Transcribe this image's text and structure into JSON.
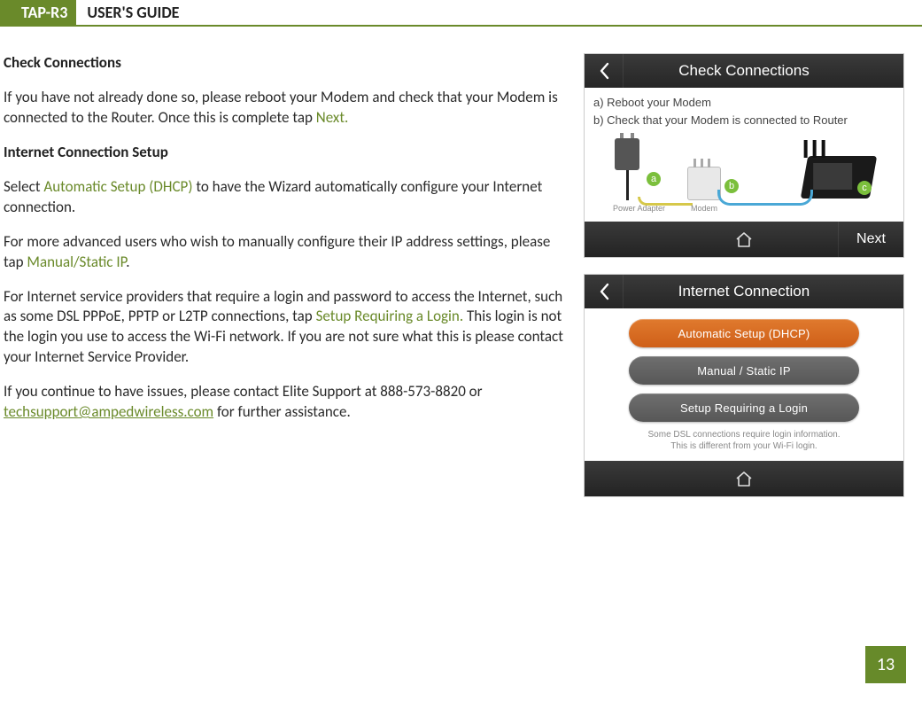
{
  "header": {
    "model": "TAP-R3",
    "title": "USER'S GUIDE"
  },
  "content": {
    "h_check": "Check Connections",
    "p1a": "If you have not already done so, please reboot your Modem and check that your Modem is connected to the Router.  Once this is complete tap ",
    "p1_next": "Next.",
    "h_setup": "Internet Connection Setup",
    "p2a": "Select ",
    "p2_auto": "Automatic Setup (DHCP)",
    "p2b": " to have the Wizard automatically configure your Internet connection.",
    "p3a": "For more advanced users who wish to manually configure their IP address settings, please tap ",
    "p3_manual": "Manual/Static IP",
    "p3b": ".",
    "p4a": "For Internet service providers that require a login and password to access the Internet, such as some DSL PPPoE, PPTP or L2TP connections, tap ",
    "p4_login": "Setup Requiring a Login.",
    "p4b": " This login is not the login you use to access the Wi-Fi network. If you are not sure what this is please contact your Internet Service Provider.",
    "p5a": "If you continue to have issues, please contact Elite Support at 888-573-8820 or ",
    "p5_email": "techsupport@ampedwireless.com",
    "p5b": " for further assistance."
  },
  "screen1": {
    "title": "Check Connections",
    "line_a": "a) Reboot your Modem",
    "line_b": "b) Check that your Modem is connected to Router",
    "caption_pa": "Power Adapter",
    "caption_modem": "Modem",
    "next": "Next"
  },
  "screen2": {
    "title": "Internet Connection",
    "btn_auto": "Automatic Setup (DHCP)",
    "btn_manual": "Manual / Static IP",
    "btn_login": "Setup Requiring a Login",
    "hint1": "Some DSL connections require login information.",
    "hint2": "This is different from your Wi-Fi login."
  },
  "page_number": "13"
}
